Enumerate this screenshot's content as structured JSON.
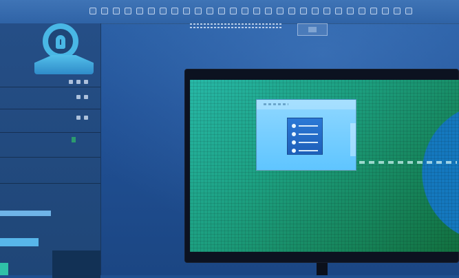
{
  "toolbar": {
    "title": "",
    "tool_icons": [
      "square-icon",
      "grid-icon",
      "circle-icon",
      "square-icon",
      "square-icon",
      "square-icon",
      "circle-icon",
      "square-icon",
      "circle-icon",
      "circle-icon",
      "square-icon",
      "circle-icon",
      "circle-icon",
      "square-icon",
      "circle-icon",
      "square-icon",
      "circle-icon",
      "square-icon",
      "circle-icon",
      "square-icon",
      "circle-icon",
      "square-icon",
      "square-icon",
      "circle-icon",
      "circle-icon",
      "square-icon",
      "circle-icon",
      "circle-icon"
    ]
  },
  "sidebar": {
    "rows": [
      {
        "label": ""
      },
      {
        "label": ""
      },
      {
        "label": ""
      },
      {
        "label": ""
      },
      {
        "label": ""
      },
      {
        "label": ""
      },
      {
        "label": ""
      },
      {
        "label": ""
      },
      {
        "label": ""
      },
      {
        "label": ""
      }
    ]
  },
  "colors": {
    "toolbar": "#2f63a6",
    "sidebar": "#214a80",
    "accent_cyan": "#49b7e5",
    "screen_green": "#1c9e7f",
    "window_blue": "#5fc5ff"
  }
}
